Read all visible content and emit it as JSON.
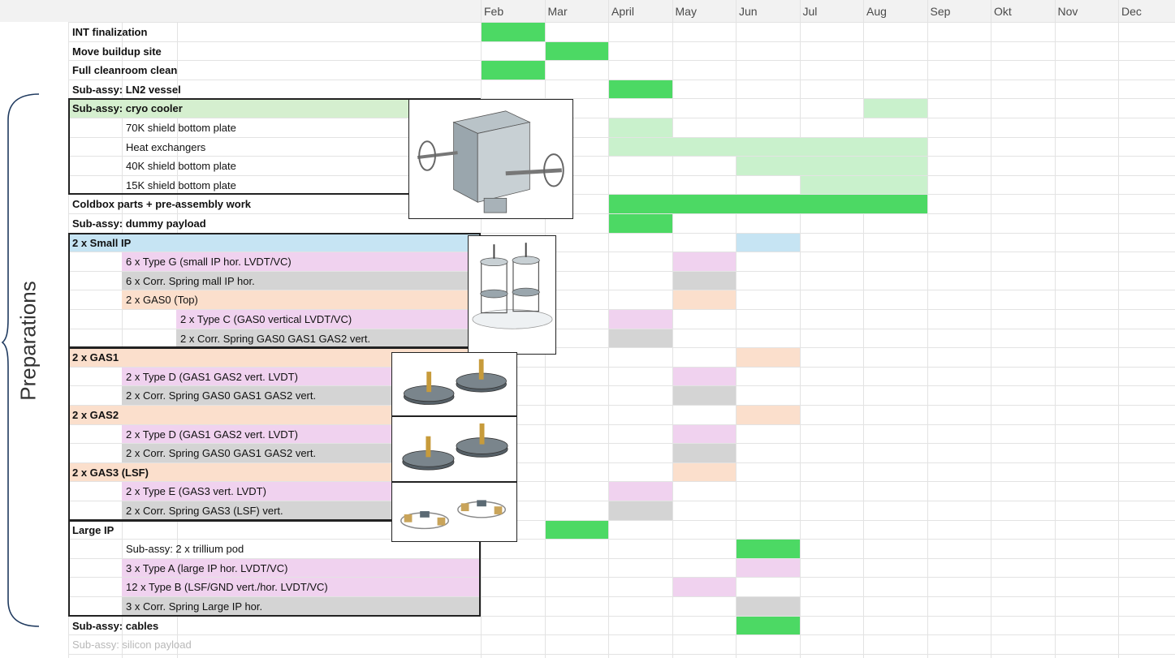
{
  "months": [
    "Feb",
    "Mar",
    "April",
    "May",
    "Jun",
    "Jul",
    "Aug",
    "Sep",
    "Okt",
    "Nov",
    "Dec"
  ],
  "side_label": "Preparations",
  "colors": {
    "green": "#4cd964",
    "light_green": "#c9f1cc",
    "green_header": "#d5efcf",
    "blue": "#c6e4f3",
    "pink": "#f0d2ef",
    "gray": "#d4d4d4",
    "peach": "#fbdfcc"
  },
  "rows": [
    {
      "label": "INT finalization",
      "indent": 0,
      "bold": true,
      "bg": null,
      "bars": [
        {
          "from": 0,
          "to": 1,
          "color": "green"
        }
      ]
    },
    {
      "label": "Move buildup site",
      "indent": 0,
      "bold": true,
      "bg": null,
      "bars": [
        {
          "from": 1,
          "to": 2,
          "color": "green"
        }
      ]
    },
    {
      "label": "Full cleanroom clean",
      "indent": 0,
      "bold": true,
      "bg": null,
      "bars": [
        {
          "from": 0,
          "to": 1,
          "color": "green"
        }
      ]
    },
    {
      "label": "Sub-assy: LN2 vessel",
      "indent": 0,
      "bold": true,
      "bg": null,
      "bars": [
        {
          "from": 2,
          "to": 3,
          "color": "green"
        }
      ]
    },
    {
      "label": "Sub-assy: cryo cooler",
      "indent": 0,
      "bold": true,
      "bg": "green_header",
      "bars": [
        {
          "from": 6,
          "to": 7,
          "color": "light_green"
        }
      ]
    },
    {
      "label": "70K shield bottom plate",
      "indent": 1,
      "bold": false,
      "bg": null,
      "bars": [
        {
          "from": 2,
          "to": 3,
          "color": "light_green"
        }
      ]
    },
    {
      "label": "Heat exchangers",
      "indent": 1,
      "bold": false,
      "bg": null,
      "bars": [
        {
          "from": 2,
          "to": 7,
          "color": "light_green"
        }
      ]
    },
    {
      "label": "40K shield bottom plate",
      "indent": 1,
      "bold": false,
      "bg": null,
      "bars": [
        {
          "from": 4,
          "to": 7,
          "color": "light_green"
        }
      ]
    },
    {
      "label": "15K shield bottom plate",
      "indent": 1,
      "bold": false,
      "bg": null,
      "bars": [
        {
          "from": 5,
          "to": 7,
          "color": "light_green"
        }
      ]
    },
    {
      "label": "Coldbox parts + pre-assembly work",
      "indent": 0,
      "bold": true,
      "bg": null,
      "bars": [
        {
          "from": 2,
          "to": 7,
          "color": "green"
        }
      ]
    },
    {
      "label": "Sub-assy: dummy payload",
      "indent": 0,
      "bold": true,
      "bg": null,
      "bars": [
        {
          "from": 2,
          "to": 3,
          "color": "green"
        }
      ]
    },
    {
      "label": "2 x Small IP",
      "indent": 0,
      "bold": true,
      "bg": "blue",
      "bars": [
        {
          "from": 4,
          "to": 5,
          "color": "blue"
        }
      ]
    },
    {
      "label": "6 x Type G (small IP hor. LVDT/VC)",
      "indent": 1,
      "bold": false,
      "bg": "pink",
      "bars": [
        {
          "from": 3,
          "to": 4,
          "color": "pink"
        }
      ]
    },
    {
      "label": "6 x Corr. Spring mall IP hor.",
      "indent": 1,
      "bold": false,
      "bg": "gray",
      "bars": [
        {
          "from": 3,
          "to": 4,
          "color": "gray"
        }
      ]
    },
    {
      "label": "2 x GAS0 (Top)",
      "indent": 1,
      "bold": false,
      "bg": "peach",
      "bars": [
        {
          "from": 3,
          "to": 4,
          "color": "peach"
        }
      ]
    },
    {
      "label": "2 x Type C (GAS0 vertical LVDT/VC)",
      "indent": 2,
      "bold": false,
      "bg": "pink",
      "bars": [
        {
          "from": 2,
          "to": 3,
          "color": "pink"
        }
      ]
    },
    {
      "label": "2 x Corr. Spring  GAS0 GAS1 GAS2 vert.",
      "indent": 2,
      "bold": false,
      "bg": "gray",
      "bars": [
        {
          "from": 2,
          "to": 3,
          "color": "gray"
        }
      ]
    },
    {
      "label": "2 x GAS1",
      "indent": 0,
      "bold": true,
      "bg": "peach",
      "bars": [
        {
          "from": 4,
          "to": 5,
          "color": "peach"
        }
      ]
    },
    {
      "label": "2 x Type D (GAS1 GAS2 vert. LVDT)",
      "indent": 1,
      "bold": false,
      "bg": "pink",
      "bars": [
        {
          "from": 3,
          "to": 4,
          "color": "pink"
        }
      ]
    },
    {
      "label": "2 x Corr. Spring  GAS0 GAS1 GAS2 vert.",
      "indent": 1,
      "bold": false,
      "bg": "gray",
      "bars": [
        {
          "from": 3,
          "to": 4,
          "color": "gray"
        }
      ]
    },
    {
      "label": "2 x GAS2",
      "indent": 0,
      "bold": true,
      "bg": "peach",
      "bars": [
        {
          "from": 4,
          "to": 5,
          "color": "peach"
        }
      ]
    },
    {
      "label": "2 x Type D (GAS1 GAS2 vert. LVDT)",
      "indent": 1,
      "bold": false,
      "bg": "pink",
      "bars": [
        {
          "from": 3,
          "to": 4,
          "color": "pink"
        }
      ]
    },
    {
      "label": "2 x Corr. Spring  GAS0 GAS1 GAS2 vert.",
      "indent": 1,
      "bold": false,
      "bg": "gray",
      "bars": [
        {
          "from": 3,
          "to": 4,
          "color": "gray"
        }
      ]
    },
    {
      "label": "2 x GAS3 (LSF)",
      "indent": 0,
      "bold": true,
      "bg": "peach",
      "bars": [
        {
          "from": 3,
          "to": 4,
          "color": "peach"
        }
      ]
    },
    {
      "label": "2 x Type E (GAS3 vert. LVDT)",
      "indent": 1,
      "bold": false,
      "bg": "pink",
      "bars": [
        {
          "from": 2,
          "to": 3,
          "color": "pink"
        }
      ]
    },
    {
      "label": "2 x Corr. Spring  GAS3 (LSF) vert.",
      "indent": 1,
      "bold": false,
      "bg": "gray",
      "bars": [
        {
          "from": 2,
          "to": 3,
          "color": "gray"
        }
      ]
    },
    {
      "label": "Large IP",
      "indent": 0,
      "bold": true,
      "bg": null,
      "bars": [
        {
          "from": 1,
          "to": 2,
          "color": "green"
        }
      ]
    },
    {
      "label": "Sub-assy: 2 x trillium pod",
      "indent": 1,
      "bold": false,
      "bg": null,
      "bars": [
        {
          "from": 4,
          "to": 5,
          "color": "green"
        }
      ]
    },
    {
      "label": "3 x Type A (large IP hor. LVDT/VC)",
      "indent": 1,
      "bold": false,
      "bg": "pink",
      "bars": [
        {
          "from": 4,
          "to": 5,
          "color": "pink"
        }
      ]
    },
    {
      "label": "12 x Type B (LSF/GND vert./hor. LVDT/VC)",
      "indent": 1,
      "bold": false,
      "bg": "pink",
      "bars": [
        {
          "from": 3,
          "to": 4,
          "color": "pink"
        }
      ]
    },
    {
      "label": "3 x Corr. Spring  Large IP hor.",
      "indent": 1,
      "bold": false,
      "bg": "gray",
      "bars": [
        {
          "from": 4,
          "to": 5,
          "color": "gray"
        }
      ]
    },
    {
      "label": "Sub-assy: cables",
      "indent": 0,
      "bold": true,
      "bg": null,
      "bars": [
        {
          "from": 4,
          "to": 5,
          "color": "green"
        }
      ]
    },
    {
      "label": "Sub-assy: silicon payload",
      "indent": 0,
      "bold": false,
      "bg": null,
      "faded": true,
      "bars": []
    }
  ],
  "group_boxes": [
    {
      "name": "cryo-cooler-group",
      "first_row": 4,
      "last_row": 8
    },
    {
      "name": "small-ip-group",
      "first_row": 11,
      "last_row": 16
    },
    {
      "name": "gas-group",
      "first_row": 17,
      "last_row": 25
    },
    {
      "name": "large-ip-group",
      "first_row": 26,
      "last_row": 30
    }
  ],
  "thumbnails": [
    {
      "name": "cryo-cooler-image",
      "icon": "cryo-cooler-render"
    },
    {
      "name": "small-ip-image",
      "icon": "small-ip-render"
    },
    {
      "name": "gas1-image",
      "icon": "gas-filter-render"
    },
    {
      "name": "gas2-image",
      "icon": "gas-filter-render"
    },
    {
      "name": "gas3-image",
      "icon": "lsf-render"
    }
  ]
}
